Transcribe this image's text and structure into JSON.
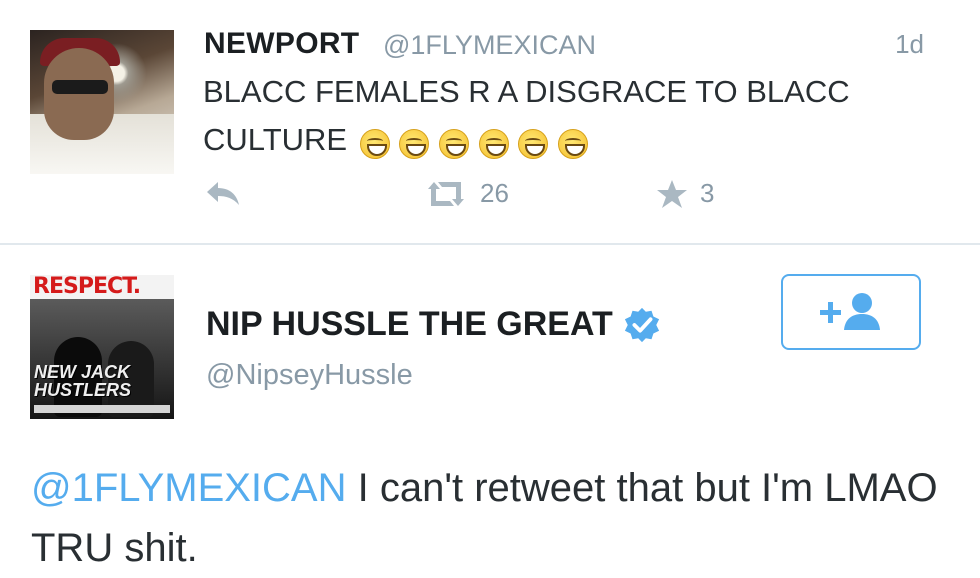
{
  "tweet1": {
    "display_name": "NEWPORT",
    "handle": "@1FLYMEXICAN",
    "time": "1d",
    "text": "BLACC FEMALES R A DISGRACE TO BLACC CULTURE",
    "emoji_count": 6,
    "emoji_name": "face-with-tears-of-joy",
    "actions": {
      "reply_icon": "reply-arrow",
      "retweet_icon": "retweet",
      "retweet_count": "26",
      "favorite_icon": "star",
      "favorite_count": "3"
    }
  },
  "tweet2": {
    "display_name": "NIP HUSSLE THE GREAT",
    "verified": true,
    "handle": "@NipseyHussle",
    "avatar": {
      "magazine": "RESPECT.",
      "cover_line": "NEW JACK HUSTLERS"
    },
    "follow_icon": "add-user",
    "mention": "@1FLYMEXICAN",
    "text": "I can't retweet that but I'm LMAO TRU shit."
  },
  "colors": {
    "accent": "#55acee",
    "muted": "#8899a6",
    "icon": "#aab8c2",
    "text": "#292f33",
    "divider": "#e1e8ed"
  }
}
